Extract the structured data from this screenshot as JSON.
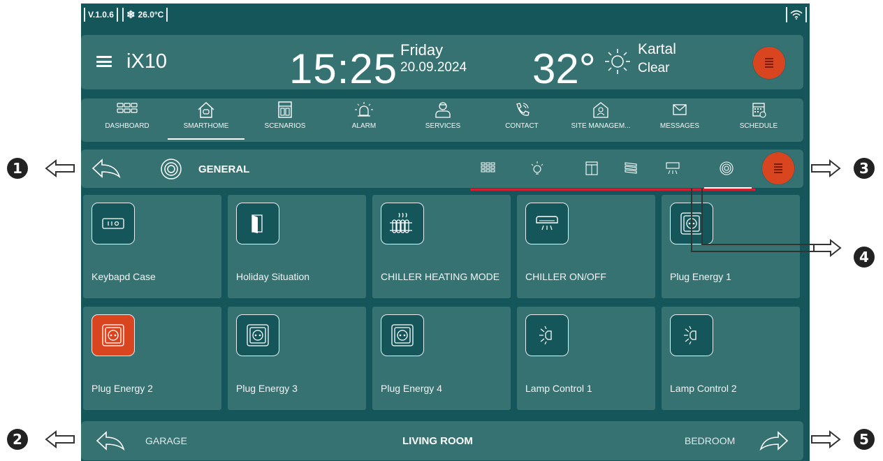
{
  "status": {
    "version": "V.1.0.6",
    "temperature": "26.0°C"
  },
  "header": {
    "brand": "iX10",
    "time": "15:25",
    "day": "Friday",
    "date": "20.09.2024",
    "outside_temp": "32°",
    "city": "Kartal",
    "condition": "Clear"
  },
  "nav": [
    {
      "label": "DASHBOARD",
      "icon": "grid-icon"
    },
    {
      "label": "SMARTHOME",
      "icon": "house-icon"
    },
    {
      "label": "SCENARIOS",
      "icon": "scenario-icon"
    },
    {
      "label": "ALARM",
      "icon": "alarm-icon"
    },
    {
      "label": "SERVICES",
      "icon": "service-person-icon"
    },
    {
      "label": "CONTACT",
      "icon": "phone-icon"
    },
    {
      "label": "SITE MANAGEM...",
      "icon": "site-management-icon"
    },
    {
      "label": "MESSAGES",
      "icon": "envelope-icon"
    },
    {
      "label": "SCHEDULE",
      "icon": "calendar-icon"
    }
  ],
  "nav_selected": "SMARTHOME",
  "toolbar": {
    "title": "GENERAL",
    "filters": [
      "all-grid-icon",
      "bulb-icon",
      "curtain-icon",
      "shutter-icon",
      "ac-icon",
      "general-icon"
    ],
    "selected_filter": "general-icon"
  },
  "devices": [
    {
      "label": "Keybapd Case",
      "icon": "keypad-icon",
      "active": false
    },
    {
      "label": "Holiday Situation",
      "icon": "door-icon",
      "active": false
    },
    {
      "label": "CHILLER HEATING MODE",
      "icon": "radiator-icon",
      "active": false
    },
    {
      "label": "CHILLER ON/OFF",
      "icon": "ac-icon",
      "active": false
    },
    {
      "label": "Plug Energy 1",
      "icon": "socket-icon",
      "active": false
    },
    {
      "label": "Plug Energy 2",
      "icon": "socket-icon",
      "active": true
    },
    {
      "label": "Plug Energy 3",
      "icon": "socket-icon",
      "active": false
    },
    {
      "label": "Plug Energy 4",
      "icon": "socket-icon",
      "active": false
    },
    {
      "label": "Lamp Control 1",
      "icon": "lamp-icon",
      "active": false
    },
    {
      "label": "Lamp Control 2",
      "icon": "lamp-icon",
      "active": false
    }
  ],
  "rooms": {
    "previous": "GARAGE",
    "current": "LIVING ROOM",
    "next": "BEDROOM"
  },
  "annotations": [
    "1",
    "2",
    "3",
    "4",
    "5"
  ],
  "colors": {
    "background": "#14565a",
    "panel": "#367272",
    "accent": "#d9451f",
    "highlight": "#d0202f"
  }
}
